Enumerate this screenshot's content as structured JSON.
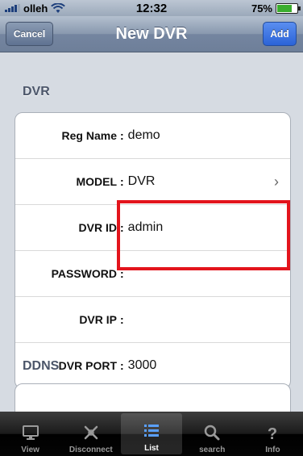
{
  "status": {
    "carrier": "olleh",
    "time": "12:32",
    "battery": "75%"
  },
  "nav": {
    "title": "New DVR",
    "cancel": "Cancel",
    "add": "Add"
  },
  "sections": {
    "dvr": "DVR",
    "ddns": "DDNS"
  },
  "fields": {
    "reg_name": {
      "label": "Reg Name",
      "value": "demo"
    },
    "model": {
      "label": "MODEL",
      "value": "DVR"
    },
    "dvr_id": {
      "label": "DVR ID",
      "value": "admin"
    },
    "password": {
      "label": "PASSWORD",
      "value": ""
    },
    "dvr_ip": {
      "label": "DVR IP",
      "value": ""
    },
    "dvr_port": {
      "label": "DVR PORT",
      "value": "3000"
    }
  },
  "tabs": [
    {
      "label": "View",
      "icon": "monitor-icon"
    },
    {
      "label": "Disconnect",
      "icon": "disconnect-icon"
    },
    {
      "label": "List",
      "icon": "list-icon"
    },
    {
      "label": "search",
      "icon": "search-icon"
    },
    {
      "label": "Info",
      "icon": "question-icon"
    }
  ],
  "colors": {
    "highlight": "#e3141c",
    "add_button": "#2b63d7"
  }
}
